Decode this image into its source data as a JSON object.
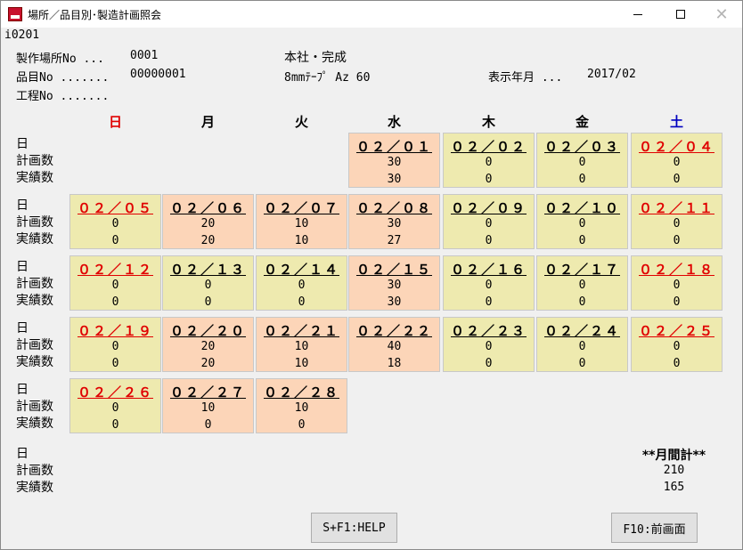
{
  "window": {
    "title": "場所／品目別･製造計画照会",
    "close_glyph": "✕"
  },
  "screen_id": "i0201",
  "header": {
    "location_label": "製作場所No ...",
    "location_no": "0001",
    "location_name": "本社・完成",
    "item_label": "品目No .......",
    "item_no": "00000001",
    "item_name": "8mmﾃｰﾌﾟ Az 60",
    "display_month_label": "表示年月 ...",
    "display_month": "2017/02",
    "process_label": "工程No ......."
  },
  "weekdays": [
    "日",
    "月",
    "火",
    "水",
    "木",
    "金",
    "土"
  ],
  "row_labels": {
    "day": "日",
    "plan": "計画数",
    "actual": "実績数"
  },
  "calendar": [
    [
      null,
      null,
      null,
      {
        "date": "０２／０１",
        "plan": "30",
        "actual": "30",
        "color": "orange",
        "holiday": false
      },
      {
        "date": "０２／０２",
        "plan": "0",
        "actual": "0",
        "color": "yellow",
        "holiday": false
      },
      {
        "date": "０２／０３",
        "plan": "0",
        "actual": "0",
        "color": "yellow",
        "holiday": false
      },
      {
        "date": "０２／０４",
        "plan": "0",
        "actual": "0",
        "color": "yellow",
        "holiday": true
      }
    ],
    [
      {
        "date": "０２／０５",
        "plan": "0",
        "actual": "0",
        "color": "yellow",
        "holiday": true
      },
      {
        "date": "０２／０６",
        "plan": "20",
        "actual": "20",
        "color": "orange",
        "holiday": false
      },
      {
        "date": "０２／０７",
        "plan": "10",
        "actual": "10",
        "color": "orange",
        "holiday": false
      },
      {
        "date": "０２／０８",
        "plan": "30",
        "actual": "27",
        "color": "orange",
        "holiday": false
      },
      {
        "date": "０２／０９",
        "plan": "0",
        "actual": "0",
        "color": "yellow",
        "holiday": false
      },
      {
        "date": "０２／１０",
        "plan": "0",
        "actual": "0",
        "color": "yellow",
        "holiday": false
      },
      {
        "date": "０２／１１",
        "plan": "0",
        "actual": "0",
        "color": "yellow",
        "holiday": true
      }
    ],
    [
      {
        "date": "０２／１２",
        "plan": "0",
        "actual": "0",
        "color": "yellow",
        "holiday": true
      },
      {
        "date": "０２／１３",
        "plan": "0",
        "actual": "0",
        "color": "yellow",
        "holiday": false
      },
      {
        "date": "０２／１４",
        "plan": "0",
        "actual": "0",
        "color": "yellow",
        "holiday": false
      },
      {
        "date": "０２／１５",
        "plan": "30",
        "actual": "30",
        "color": "orange",
        "holiday": false
      },
      {
        "date": "０２／１６",
        "plan": "0",
        "actual": "0",
        "color": "yellow",
        "holiday": false
      },
      {
        "date": "０２／１７",
        "plan": "0",
        "actual": "0",
        "color": "yellow",
        "holiday": false
      },
      {
        "date": "０２／１８",
        "plan": "0",
        "actual": "0",
        "color": "yellow",
        "holiday": true
      }
    ],
    [
      {
        "date": "０２／１９",
        "plan": "0",
        "actual": "0",
        "color": "yellow",
        "holiday": true
      },
      {
        "date": "０２／２０",
        "plan": "20",
        "actual": "20",
        "color": "orange",
        "holiday": false
      },
      {
        "date": "０２／２１",
        "plan": "10",
        "actual": "10",
        "color": "orange",
        "holiday": false
      },
      {
        "date": "０２／２２",
        "plan": "40",
        "actual": "18",
        "color": "orange",
        "holiday": false
      },
      {
        "date": "０２／２３",
        "plan": "0",
        "actual": "0",
        "color": "yellow",
        "holiday": false
      },
      {
        "date": "０２／２４",
        "plan": "0",
        "actual": "0",
        "color": "yellow",
        "holiday": false
      },
      {
        "date": "０２／２５",
        "plan": "0",
        "actual": "0",
        "color": "yellow",
        "holiday": true
      }
    ],
    [
      {
        "date": "０２／２６",
        "plan": "0",
        "actual": "0",
        "color": "yellow",
        "holiday": true
      },
      {
        "date": "０２／２７",
        "plan": "10",
        "actual": "0",
        "color": "orange",
        "holiday": false
      },
      {
        "date": "０２／２８",
        "plan": "10",
        "actual": "0",
        "color": "orange",
        "holiday": false
      },
      null,
      null,
      null,
      null
    ]
  ],
  "monthly_total": {
    "label": "**月間計**",
    "plan": "210",
    "actual": "165"
  },
  "buttons": {
    "help": "S+F1:HELP",
    "back": "F10:前画面"
  },
  "colors": {
    "cell_yellow": "#eeeaaf",
    "cell_orange": "#fcd5b8",
    "holiday_red": "#e00000",
    "saturday_blue": "#0000c0"
  }
}
